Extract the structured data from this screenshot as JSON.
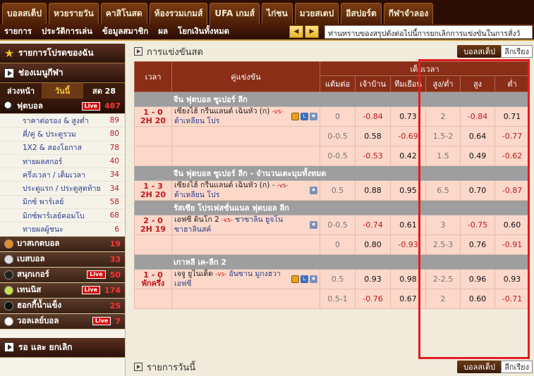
{
  "topnav": [
    "บอลสเต็ป",
    "หวยรายวัน",
    "คาสิโนสด",
    "ห้องรวมเกมส์",
    "UFA เกมส์",
    "ไก่ชน",
    "มวยสเตป",
    "อีสปอร์ต",
    "กีฬาจำลอง"
  ],
  "subnav": [
    "รายการ",
    "ประวัติการเล่น",
    "ข้อมูลสมาชิก",
    "ผล",
    "โยกเงินทั้งหมด"
  ],
  "ticker": "ท่านทราบของสรุปดังต่อไปนี้การยกเลิกการแข่งขันในการสั่งวั",
  "sidebar": {
    "promo_title": "รายการโปรดของฉัน",
    "sports_menu_title": "ช่องเมนูกีฬา",
    "day_tabs": [
      "ล่วงหน้า",
      "วันนี้",
      "สด 28"
    ],
    "football": {
      "name": "ฟุตบอล",
      "live": "Live",
      "count": "487"
    },
    "football_sub": [
      {
        "name": "ราคาต่อรอง & สูงต่ำ",
        "count": "89"
      },
      {
        "name": "คี่/คู่ & ประตูรวม",
        "count": "80"
      },
      {
        "name": "1X2 & สองโอกาส",
        "count": "78"
      },
      {
        "name": "ทายผลสกอร์",
        "count": "40"
      },
      {
        "name": "ครึ่งเวลา / เต็มเวลา",
        "count": "34"
      },
      {
        "name": "ประตูแรก / ประตูสุดท้าย",
        "count": "34"
      },
      {
        "name": "มิกซ์ พาร์เลย์",
        "count": "58"
      },
      {
        "name": "มิกซ์พาร์เลย์คอมโบ",
        "count": "68"
      },
      {
        "name": "ทายผลผู้ชนะ",
        "count": "6"
      }
    ],
    "cats": [
      {
        "name": "บาสเกตบอล",
        "live": "",
        "count": "19",
        "color": "#e58a2a"
      },
      {
        "name": "เบสบอล",
        "live": "",
        "count": "33",
        "color": "#dddddd"
      },
      {
        "name": "สนุกเกอร์",
        "live": "Live",
        "count": "50",
        "color": "#222222"
      },
      {
        "name": "เทนนิส",
        "live": "Live",
        "count": "174",
        "color": "#c9e04a"
      },
      {
        "name": "ฮอกกี้น้ำแข็ง",
        "live": "",
        "count": "25",
        "color": "#111111"
      },
      {
        "name": "วอลเลย์บอล",
        "live": "Live",
        "count": "7",
        "color": "#ffffff"
      }
    ],
    "bottom_title": "รอ และ ยกเลิก"
  },
  "main": {
    "section_title": "การแข่งขันสด",
    "btn_dark": "บอลสเต็ป",
    "btn_light": "ลีกเรียง",
    "headers": {
      "time": "เวลา",
      "match": "คู่แข่งขัน",
      "full": "เต็มเวลา",
      "hdp": "แต้มต่อ",
      "home": "เจ้าบ้าน",
      "away": "ทีมเยือน",
      "ou": "สูง/ต่ำ",
      "over": "สูง",
      "under": "ต่ำ"
    },
    "leagues": [
      {
        "name": "จีน ฟุตบอล ซูเปอร์ ลีก",
        "rows": [
          {
            "score": "1 - 0",
            "clock": "2H 20",
            "home": "เซียงไฮ้ กรีนแลนด์ เฉินหัว (ก)",
            "away": "ต้าเหลียน โปร",
            "icons": "tls",
            "hdp": "0",
            "home_odds": "-0.84",
            "away_odds": "0.73",
            "ou": "2",
            "over": "-0.84",
            "under": "0.71"
          },
          {
            "score": "",
            "clock": "",
            "home": "",
            "away": "",
            "icons": "",
            "hdp": "0-0.5",
            "home_odds": "0.58",
            "away_odds": "-0.69",
            "ou": "1.5-2",
            "over": "0.64",
            "under": "-0.77"
          },
          {
            "score": "",
            "clock": "",
            "home": "",
            "away": "",
            "icons": "",
            "hdp": "0-0.5",
            "home_odds": "-0.53",
            "away_odds": "0.42",
            "ou": "1.5",
            "over": "0.49",
            "under": "-0.62"
          }
        ]
      },
      {
        "name": "จีน ฟุตบอล ซูเปอร์ ลีก - จำนวนเตะมุมทั้งหมด",
        "rows": [
          {
            "score": "1 - 3",
            "clock": "2H 20",
            "home": "เซียงไฮ้ กรีนแลนด์ เฉินหัว (ก) -",
            "away": "ต้าเหลียน โปร",
            "icons": "s",
            "hdp": "0.5",
            "home_odds": "0.88",
            "away_odds": "0.95",
            "ou": "6.5",
            "over": "0.70",
            "under": "-0.87"
          }
        ]
      },
      {
        "name": "รัสเซีย โปรเฟสชั่นแนล ฟุตบอล ลีก",
        "rows": [
          {
            "score": "2 - 0",
            "clock": "2H 19",
            "home": "เอฟซี ดินโก 2",
            "away": "ชาซาลิน ยูจโน ซาฮาลินสค์",
            "icons": "s",
            "hdp": "0-0.5",
            "home_odds": "-0.74",
            "away_odds": "0.61",
            "ou": "3",
            "over": "-0.75",
            "under": "0.60"
          },
          {
            "score": "",
            "clock": "",
            "home": "",
            "away": "",
            "icons": "",
            "hdp": "0",
            "home_odds": "0.80",
            "away_odds": "-0.93",
            "ou": "2.5-3",
            "over": "0.76",
            "under": "-0.91"
          }
        ]
      },
      {
        "name": "เกาหลี เค-ลีก 2",
        "rows": [
          {
            "score": "1 - 0",
            "clock": "พักครึ่ง",
            "home": "เจจู ยูไนเต็ด",
            "away": "อันซาน มูกงฮวา เอฟซี",
            "icons": "tls",
            "hdp": "0.5",
            "home_odds": "0.93",
            "away_odds": "0.98",
            "ou": "2-2.5",
            "over": "0.96",
            "under": "0.93"
          },
          {
            "score": "",
            "clock": "",
            "home": "",
            "away": "",
            "icons": "",
            "hdp": "0.5-1",
            "home_odds": "-0.76",
            "away_odds": "0.67",
            "ou": "2",
            "over": "0.60",
            "under": "-0.71"
          }
        ]
      }
    ],
    "today_title": "รายการวันนี้"
  }
}
